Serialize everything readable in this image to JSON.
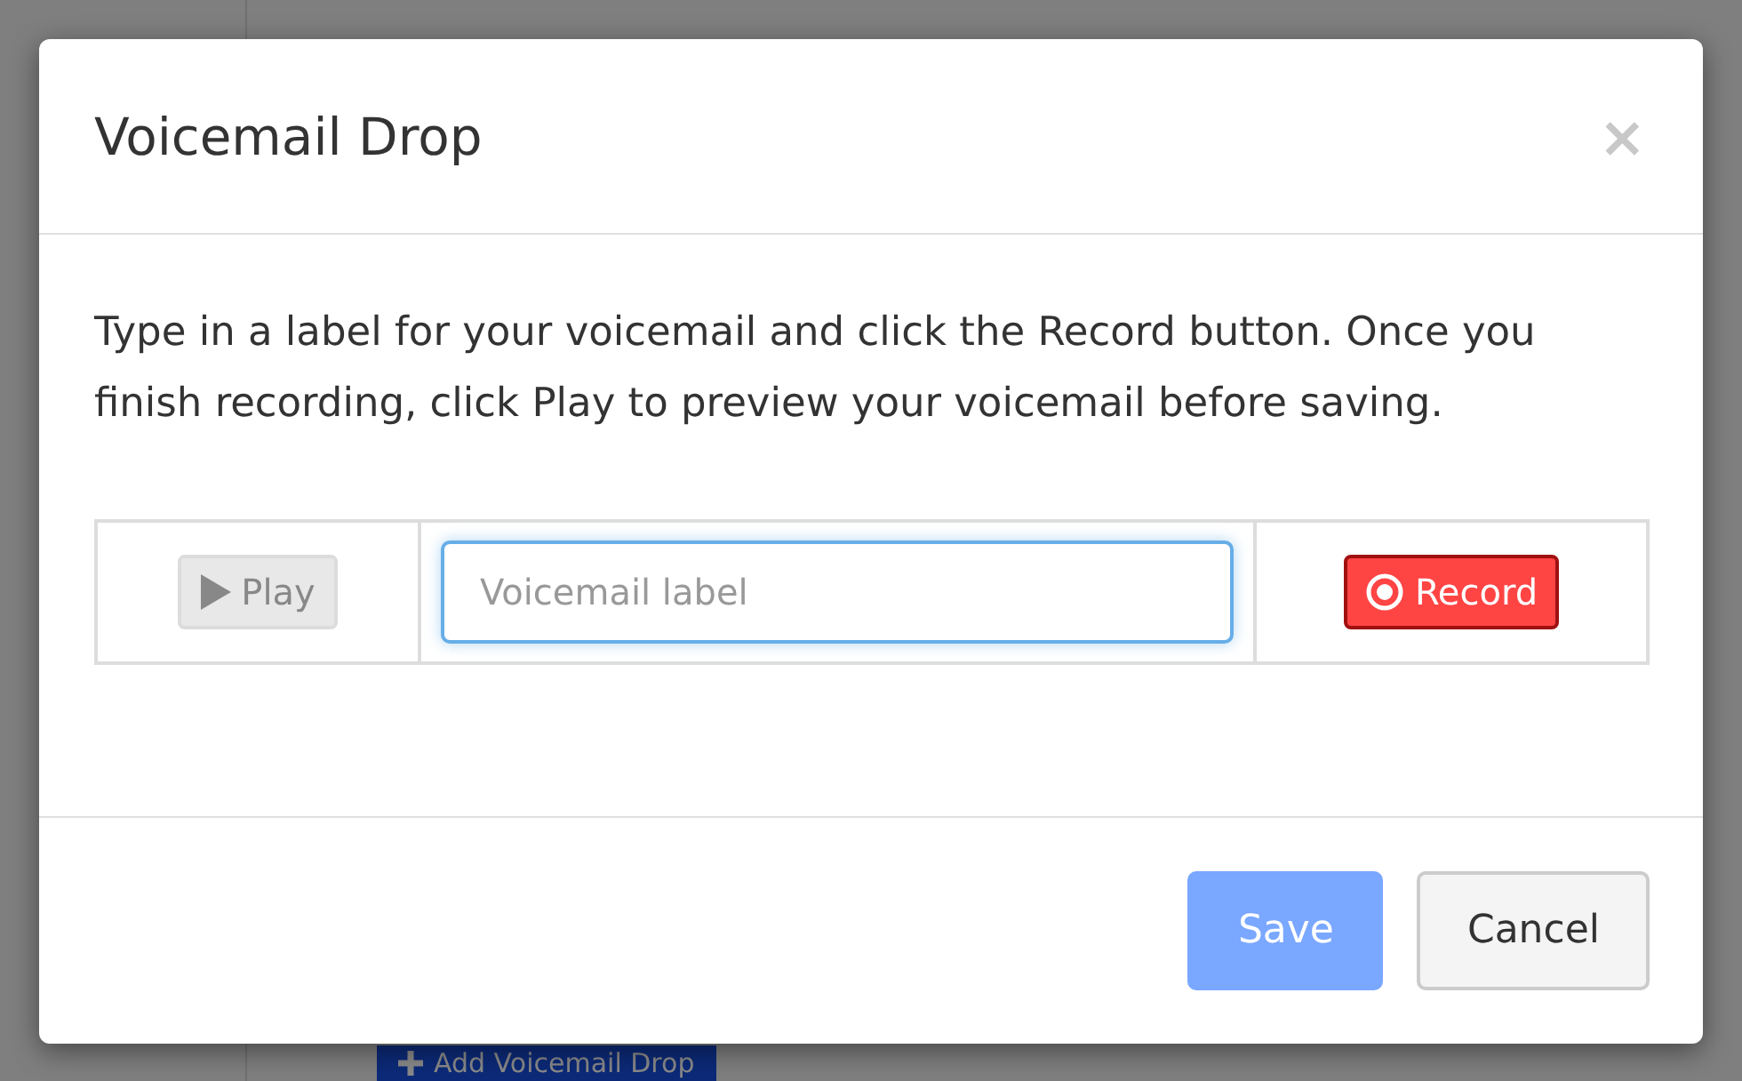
{
  "background": {
    "add_button": {
      "label": "Add Voicemail Drop"
    }
  },
  "dialog": {
    "title": "Voicemail Drop",
    "close": "×",
    "instructions": "Type in a label for your voicemail and click the Record button. Once you finish recording, click Play to preview your voicemail before saving.",
    "recorder": {
      "play": {
        "label": "Play",
        "disabled": true
      },
      "label_field": {
        "placeholder": "Voicemail label"
      },
      "record": {
        "label": "Record"
      }
    },
    "buttons": [
      {
        "label": "Save",
        "kind": "primary",
        "disabled": true
      },
      {
        "label": "Cancel",
        "kind": "secondary",
        "disabled": false
      }
    ]
  }
}
